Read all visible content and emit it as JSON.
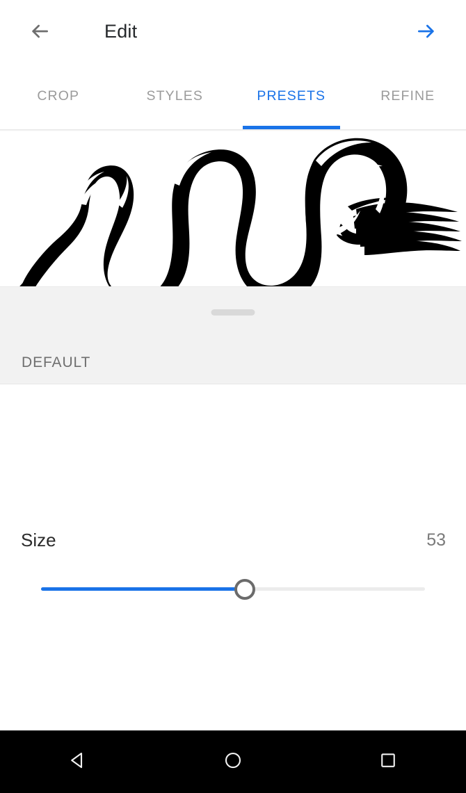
{
  "app": {
    "header": {
      "title": "Edit",
      "back_icon": "arrow-left-icon",
      "forward_icon": "arrow-right-icon",
      "back_color": "#6e6e6e",
      "forward_color": "#1a73e8"
    },
    "tabs": {
      "active_index": 2,
      "accent_color": "#1a73e8",
      "inactive_color": "#9b9b9b",
      "items": [
        {
          "label": "CROP"
        },
        {
          "label": "STYLES"
        },
        {
          "label": "PRESETS"
        },
        {
          "label": "REFINE"
        }
      ]
    },
    "preview": {
      "name": "brush-stroke-snake-artwork",
      "background": "#ffffff",
      "ink_color": "#000000"
    },
    "preset_sheet": {
      "handle_icon": "drag-handle-pill",
      "preset_label": "DEFAULT",
      "background": "#f2f2f2"
    },
    "size_slider": {
      "label": "Size",
      "value": "53",
      "value_number": 53,
      "min": 0,
      "max": 100,
      "fill_color": "#1a73e8",
      "track_color": "#ececec",
      "thumb_color": "#6b6b6b"
    },
    "navbar": {
      "background": "#000000",
      "items": [
        {
          "icon": "android-back-triangle-icon",
          "label": "Back"
        },
        {
          "icon": "android-home-circle-icon",
          "label": "Home"
        },
        {
          "icon": "android-recents-square-icon",
          "label": "Recents"
        }
      ]
    }
  }
}
